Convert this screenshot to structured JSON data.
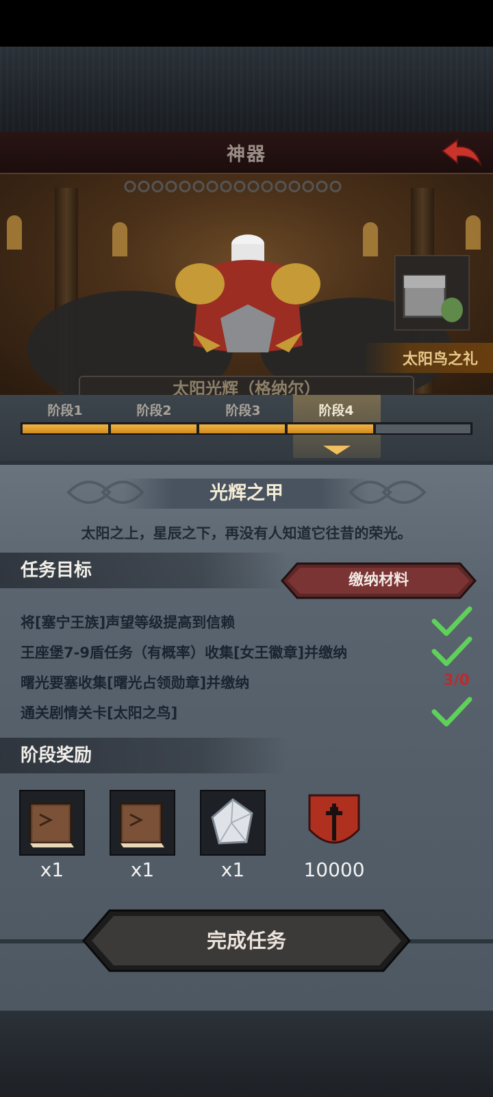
{
  "header": {
    "title": "神器"
  },
  "scene": {
    "gift_label": "太阳鸟之礼",
    "relic_name_partial": "太阳光辉（格纳尔）"
  },
  "stages": {
    "tabs": [
      {
        "label": "阶段1"
      },
      {
        "label": "阶段2"
      },
      {
        "label": "阶段3"
      },
      {
        "label": "阶段4"
      }
    ],
    "active_index": 3,
    "filled_segments": 4,
    "total_segments": 5
  },
  "relic": {
    "title": "光辉之甲",
    "description": "太阳之上，星辰之下，再没有人知道它往昔的荣光。"
  },
  "tasks": {
    "header": "任务目标",
    "submit_label": "缴纳材料",
    "items": [
      {
        "text": "将[塞宁王族]声望等级提高到信赖",
        "status": "complete"
      },
      {
        "text": "王座堡7-9盾任务（有概率）收集[女王徽章]并缴纳",
        "status": "complete"
      },
      {
        "text": "曙光要塞收集[曙光占领勋章]并缴纳",
        "status": "progress",
        "progress": "3/0"
      },
      {
        "text": "通关剧情关卡[太阳之鸟]",
        "status": "complete"
      }
    ]
  },
  "rewards": {
    "header": "阶段奖励",
    "items": [
      {
        "icon": "book-icon",
        "qty": "x1"
      },
      {
        "icon": "book-icon",
        "qty": "x1"
      },
      {
        "icon": "crystal-icon",
        "qty": "x1"
      },
      {
        "icon": "shield-emblem-icon",
        "qty": "10000"
      }
    ]
  },
  "actions": {
    "complete_label": "完成任务"
  },
  "colors": {
    "progress_fill": "#e8a030",
    "check": "#5fd15a",
    "count_red": "#b52e32",
    "title_bar": "#1c0d0d"
  }
}
